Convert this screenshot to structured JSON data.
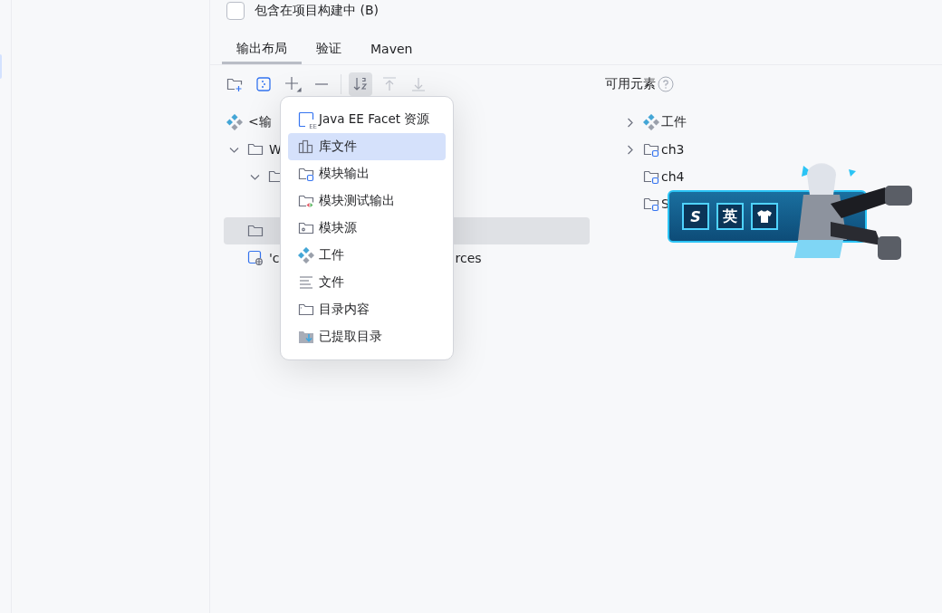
{
  "include_in_build": {
    "label": "包含在项目构建中 (B)",
    "checked": false
  },
  "tabs": [
    {
      "label": "输出布局",
      "selected": true
    },
    {
      "label": "验证",
      "selected": false
    },
    {
      "label": "Maven",
      "selected": false
    }
  ],
  "toolbar": [
    {
      "kind": "add-folder",
      "pressed": false,
      "disabled": false
    },
    {
      "kind": "module",
      "pressed": false,
      "disabled": false
    },
    {
      "kind": "add",
      "pressed": false,
      "disabled": false
    },
    {
      "kind": "remove",
      "pressed": false,
      "disabled": false
    },
    {
      "kind": "sort",
      "pressed": true,
      "disabled": false
    },
    {
      "kind": "up",
      "pressed": false,
      "disabled": true
    },
    {
      "kind": "down",
      "pressed": false,
      "disabled": true
    }
  ],
  "output_tree": [
    {
      "kind": "artifact",
      "label": "<输",
      "selected": false
    },
    {
      "kind": "folder",
      "label": "W",
      "selected": false,
      "expanded": true,
      "children": [
        {
          "kind": "folder",
          "selected": false,
          "expanded": true
        },
        {
          "kind": "folder",
          "selected": true
        },
        {
          "kind": "web",
          "label": "'c",
          "label_tail": "rces",
          "selected": false
        }
      ]
    }
  ],
  "available": {
    "title": "可用元素",
    "tree": [
      {
        "kind": "artifact",
        "label": "工件",
        "expanded": false
      },
      {
        "kind": "module",
        "label": "ch3",
        "expanded": false
      },
      {
        "kind": "module",
        "label": "ch4"
      },
      {
        "kind": "module",
        "label": "S"
      }
    ]
  },
  "add_menu": [
    {
      "kind": "ee",
      "icon_text": "EE",
      "label": "Java EE Facet 资源",
      "selected": false
    },
    {
      "kind": "library",
      "label": "库文件",
      "selected": true
    },
    {
      "kind": "module-output",
      "label": "模块输出",
      "selected": false
    },
    {
      "kind": "module-test",
      "label": "模块测试输出",
      "selected": false
    },
    {
      "kind": "module-source",
      "label": "模块源",
      "selected": false
    },
    {
      "kind": "artifact",
      "label": "工件",
      "selected": false
    },
    {
      "kind": "file",
      "label": "文件",
      "selected": false
    },
    {
      "kind": "dir-content",
      "label": "目录内容",
      "selected": false
    },
    {
      "kind": "extracted-dir",
      "label": "已提取目录",
      "selected": false
    }
  ],
  "ime_toolbar": {
    "buttons": [
      {
        "kind": "logo",
        "label": "S"
      },
      {
        "kind": "text",
        "label": "英"
      },
      {
        "kind": "skin"
      }
    ]
  }
}
